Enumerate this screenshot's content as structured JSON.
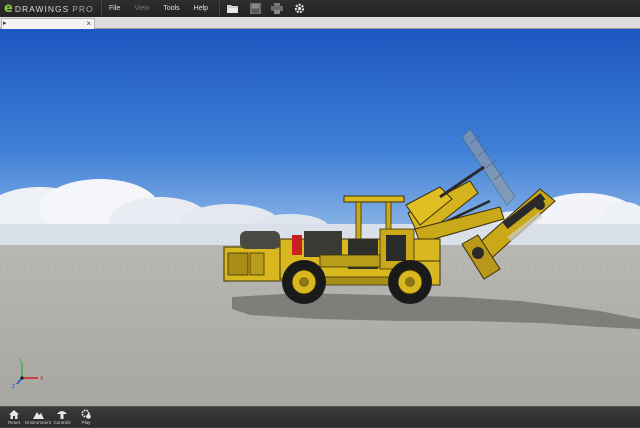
{
  "app": {
    "logo_mark": "e",
    "logo_word": "DRAWINGS",
    "logo_edition": "PRO"
  },
  "menu": {
    "items": [
      {
        "label": "File",
        "enabled": true
      },
      {
        "label": "View",
        "enabled": false
      },
      {
        "label": "Tools",
        "enabled": true
      },
      {
        "label": "Help",
        "enabled": true
      }
    ]
  },
  "toolbar": {
    "icons": [
      "folder-open-icon",
      "save-icon",
      "print-icon",
      "settings-gear-icon"
    ]
  },
  "tab": {
    "arrow": "▸",
    "close": "×"
  },
  "triad": {
    "x": "X",
    "y": "Y",
    "z": "Z"
  },
  "bottom_toolbar": {
    "buttons": [
      {
        "label": "Reset",
        "icon": "home-icon"
      },
      {
        "label": "Environment",
        "icon": "mountain-icon"
      },
      {
        "label": "Controls",
        "icon": "mushroom-icon"
      },
      {
        "label": "Play",
        "icon": "play-gear-icon"
      }
    ]
  },
  "colors": {
    "sky_top": "#1f5bc4",
    "sky_bottom": "#8cb6e8",
    "floor": "#b4b2ae",
    "machine": "#d9b71e",
    "accent_green": "#8cc63f"
  }
}
